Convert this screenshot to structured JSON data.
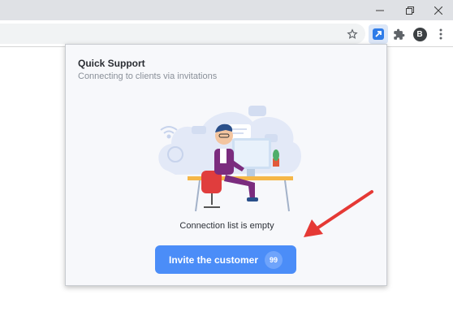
{
  "popup": {
    "title": "Quick Support",
    "subtitle": "Connecting to clients via invitations",
    "empty_message": "Connection list is empty",
    "invite_button": {
      "label": "Invite the customer",
      "badge": "99"
    }
  },
  "browser": {
    "profile_initial": "B",
    "icons": [
      "minimize-icon",
      "maximize-icon",
      "close-icon",
      "star-icon",
      "extension-icon",
      "puzzle-icon",
      "more-vert-icon"
    ]
  },
  "colors": {
    "accent": "#4b8df8",
    "annotation_arrow": "#e53935"
  }
}
